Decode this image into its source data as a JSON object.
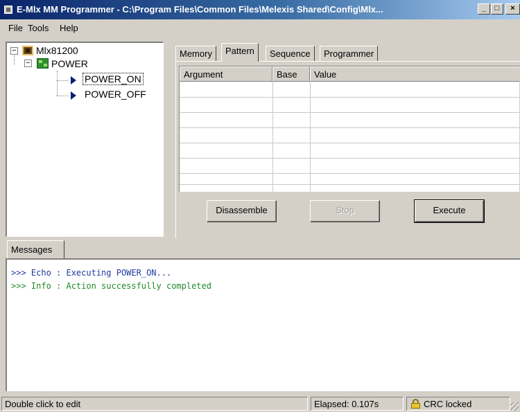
{
  "window": {
    "title": "E-Mlx MM Programmer - C:\\Program Files\\Common Files\\Melexis Shared\\Config\\Mlx...",
    "controls": {
      "minimize": "_",
      "maximize": "□",
      "close": "×"
    }
  },
  "menu": {
    "items": [
      "File",
      "Tools",
      "Help"
    ]
  },
  "tree": {
    "root": {
      "label": "Mlx81200",
      "expander": "−"
    },
    "group": {
      "label": "POWER",
      "expander": "−"
    },
    "items": [
      {
        "label": "POWER_ON",
        "selected": true
      },
      {
        "label": "POWER_OFF",
        "selected": false
      }
    ]
  },
  "tabs": {
    "items": [
      "Memory",
      "Pattern",
      "Sequence",
      "Programmer"
    ],
    "active": "Pattern"
  },
  "grid": {
    "columns": [
      "Argument",
      "Base",
      "Value"
    ],
    "rows": []
  },
  "buttons": {
    "disassemble": "Disassemble",
    "stop": "Stop",
    "execute": "Execute"
  },
  "messages": {
    "tab_label": "Messages",
    "lines": [
      {
        "text": ">>> Echo : Executing POWER_ON...",
        "color": "#1f3a9e"
      },
      {
        "text": ">>> Info : Action successfully completed",
        "color": "#1f8a2a"
      }
    ]
  },
  "status": {
    "hint": "Double click to edit",
    "elapsed": "Elapsed: 0.107s",
    "crc": "CRC locked"
  },
  "colors": {
    "titlebar_start": "#0a246a",
    "titlebar_end": "#a6caf0",
    "face": "#d4d0c8",
    "arrow": "#0a1f7a"
  }
}
